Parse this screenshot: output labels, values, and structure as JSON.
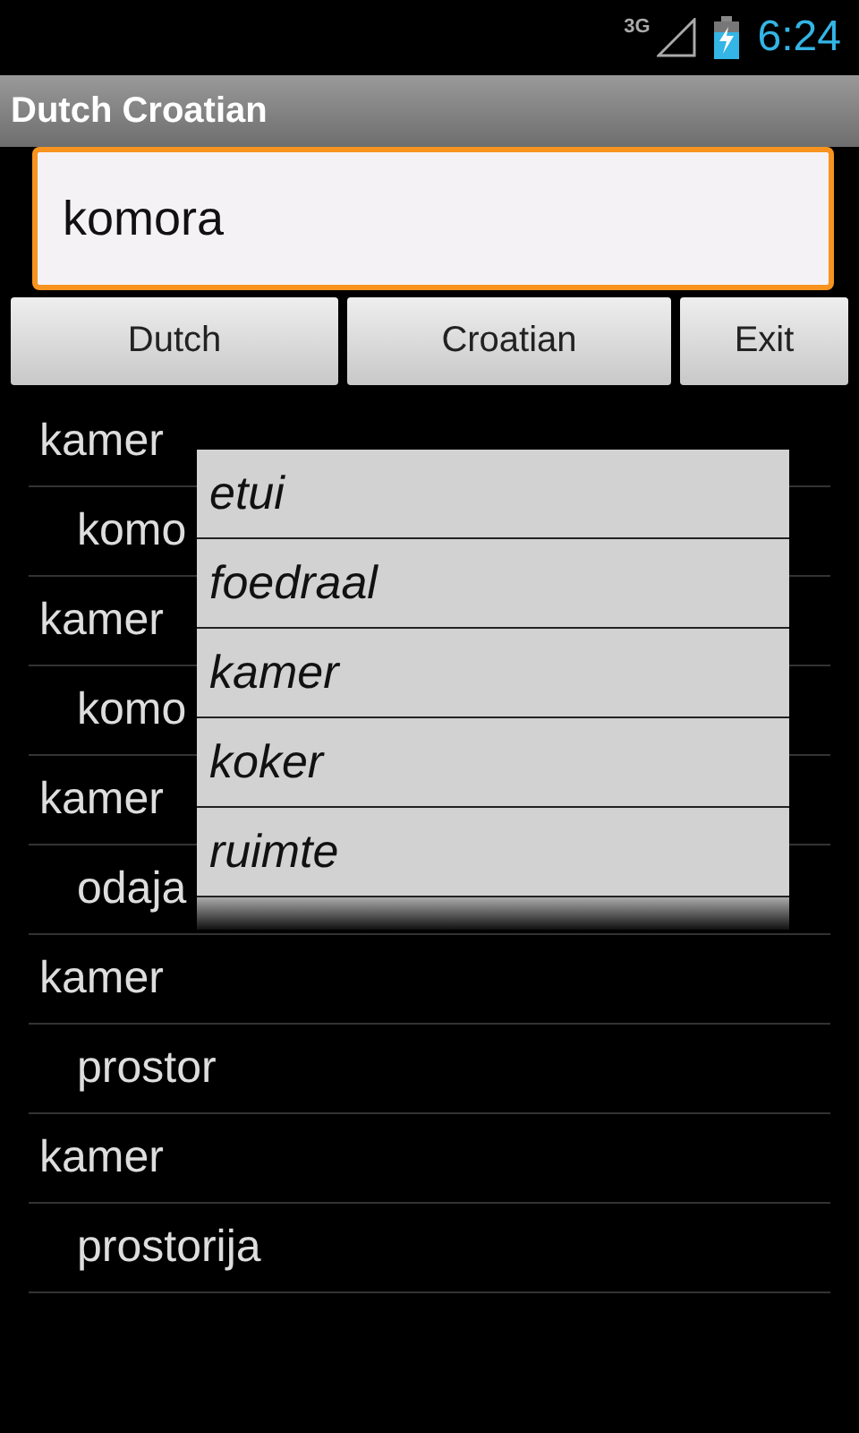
{
  "status_bar": {
    "network": "3G",
    "time": "6:24"
  },
  "title_bar": {
    "title": "Dutch Croatian"
  },
  "search": {
    "value": "komora"
  },
  "buttons": [
    "Dutch",
    "Croatian",
    "Exit"
  ],
  "results": [
    {
      "kind": "headword",
      "text": "kamer"
    },
    {
      "kind": "translation",
      "text": "komo"
    },
    {
      "kind": "headword",
      "text": "kamer"
    },
    {
      "kind": "translation",
      "text": "komo"
    },
    {
      "kind": "headword",
      "text": "kamer"
    },
    {
      "kind": "translation",
      "text": "odaja"
    },
    {
      "kind": "headword",
      "text": "kamer"
    },
    {
      "kind": "translation",
      "text": "prostor"
    },
    {
      "kind": "headword",
      "text": "kamer"
    },
    {
      "kind": "translation",
      "text": "prostorija"
    }
  ],
  "suggestions": [
    "etui",
    "foedraal",
    "kamer",
    "koker",
    "ruimte"
  ]
}
